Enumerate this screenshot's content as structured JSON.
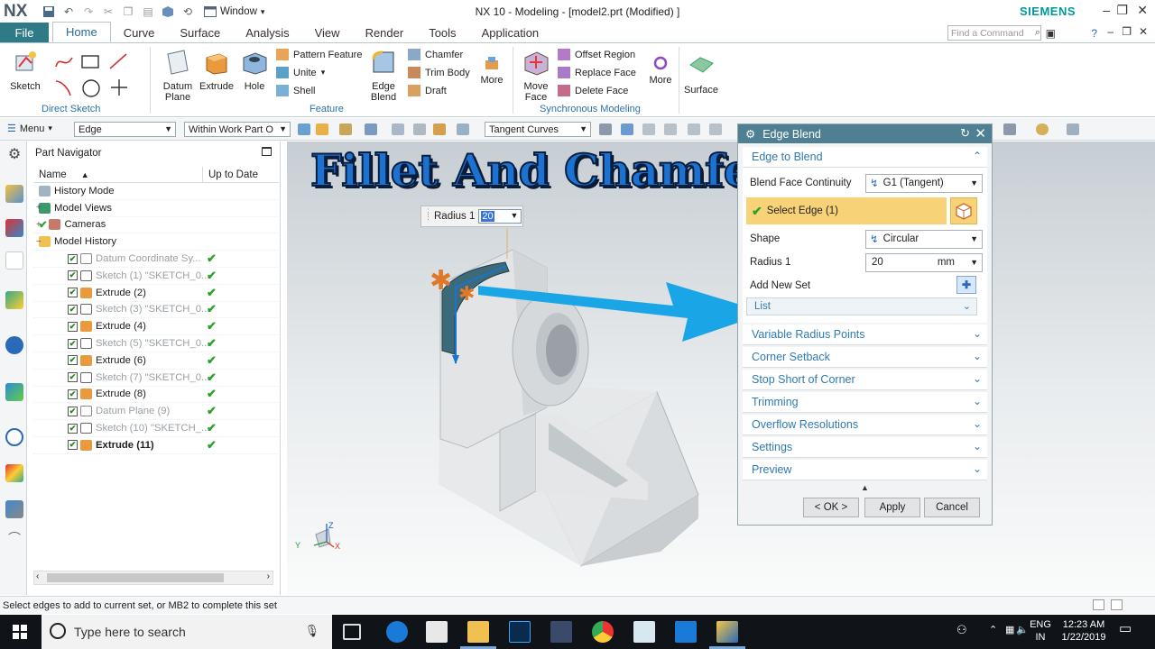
{
  "app": {
    "logo": "NX",
    "window_menu": "Window",
    "title": "NX 10 - Modeling - [model2.prt (Modified) ]",
    "brand": "SIEMENS"
  },
  "tabs": {
    "file": "File",
    "items": [
      "Home",
      "Curve",
      "Surface",
      "Analysis",
      "View",
      "Render",
      "Tools",
      "Application"
    ],
    "active": "Home",
    "find_placeholder": "Find a Command"
  },
  "ribbon": {
    "direct_sketch": {
      "sketch": "Sketch",
      "label": "Direct Sketch"
    },
    "feature": {
      "datum_plane_1": "Datum",
      "datum_plane_2": "Plane",
      "extrude": "Extrude",
      "hole": "Hole",
      "pattern_feature": "Pattern Feature",
      "unite": "Unite",
      "shell": "Shell",
      "edge_blend_1": "Edge",
      "edge_blend_2": "Blend",
      "chamfer": "Chamfer",
      "trim_body": "Trim Body",
      "draft": "Draft",
      "more": "More",
      "label": "Feature"
    },
    "sync": {
      "move_face_1": "Move",
      "move_face_2": "Face",
      "offset_region": "Offset Region",
      "replace_face": "Replace Face",
      "delete_face": "Delete Face",
      "more": "More",
      "label": "Synchronous Modeling"
    },
    "surface": "Surface"
  },
  "selection_bar": {
    "menu": "Menu",
    "type_filter": "Edge",
    "scope": "Within Work Part O",
    "curve_rule": "Tangent Curves"
  },
  "part_navigator": {
    "title": "Part Navigator",
    "col_name": "Name",
    "col_uptodate": "Up to Date",
    "items": [
      {
        "name": "History Mode",
        "state": "normal",
        "check": ""
      },
      {
        "name": "Model Views",
        "state": "normal",
        "check": ""
      },
      {
        "name": "Cameras",
        "state": "normal",
        "check": ""
      },
      {
        "name": "Model History",
        "state": "normal",
        "check": ""
      },
      {
        "name": "Datum Coordinate Sy...",
        "state": "dim",
        "check": "✔"
      },
      {
        "name": "Sketch (1) \"SKETCH_0...",
        "state": "dim",
        "check": "✔"
      },
      {
        "name": "Extrude (2)",
        "state": "normal",
        "check": "✔"
      },
      {
        "name": "Sketch (3) \"SKETCH_0...",
        "state": "dim",
        "check": "✔"
      },
      {
        "name": "Extrude (4)",
        "state": "normal",
        "check": "✔"
      },
      {
        "name": "Sketch (5) \"SKETCH_0...",
        "state": "dim",
        "check": "✔"
      },
      {
        "name": "Extrude (6)",
        "state": "normal",
        "check": "✔"
      },
      {
        "name": "Sketch (7) \"SKETCH_0...",
        "state": "dim",
        "check": "✔"
      },
      {
        "name": "Extrude (8)",
        "state": "normal",
        "check": "✔"
      },
      {
        "name": "Datum Plane (9)",
        "state": "dim",
        "check": "✔"
      },
      {
        "name": "Sketch (10) \"SKETCH_...",
        "state": "dim",
        "check": "✔"
      },
      {
        "name": "Extrude (11)",
        "state": "bold",
        "check": "✔"
      }
    ]
  },
  "viewport": {
    "overlay_title": "Fillet And Chamfer",
    "radius_label": "Radius 1",
    "radius_value": "20",
    "triad_y": "Y",
    "triad_z": "Z",
    "triad_x": "X"
  },
  "edge_blend": {
    "title": "Edge Blend",
    "section_edge": "Edge to Blend",
    "continuity_label": "Blend Face Continuity",
    "continuity_value": "G1 (Tangent)",
    "select_edge": "Select Edge (1)",
    "shape_label": "Shape",
    "shape_value": "Circular",
    "radius_label": "Radius 1",
    "radius_value": "20",
    "radius_unit": "mm",
    "add_new_set": "Add New Set",
    "list": "List",
    "collapsed": [
      "Variable Radius Points",
      "Corner Setback",
      "Stop Short of Corner",
      "Trimming",
      "Overflow Resolutions",
      "Settings",
      "Preview"
    ],
    "ok": "< OK >",
    "apply": "Apply",
    "cancel": "Cancel"
  },
  "status_text": "Select edges to add to current set, or MB2 to complete this set",
  "taskbar": {
    "search_placeholder": "Type here to search",
    "lang_1": "ENG",
    "lang_2": "IN",
    "time": "12:23 AM",
    "date": "1/22/2019"
  },
  "colors": {
    "accent": "#2f7a87",
    "dialog_title": "#4e7f93",
    "highlight": "#f7d277",
    "arrow": "#1aa6e6"
  }
}
